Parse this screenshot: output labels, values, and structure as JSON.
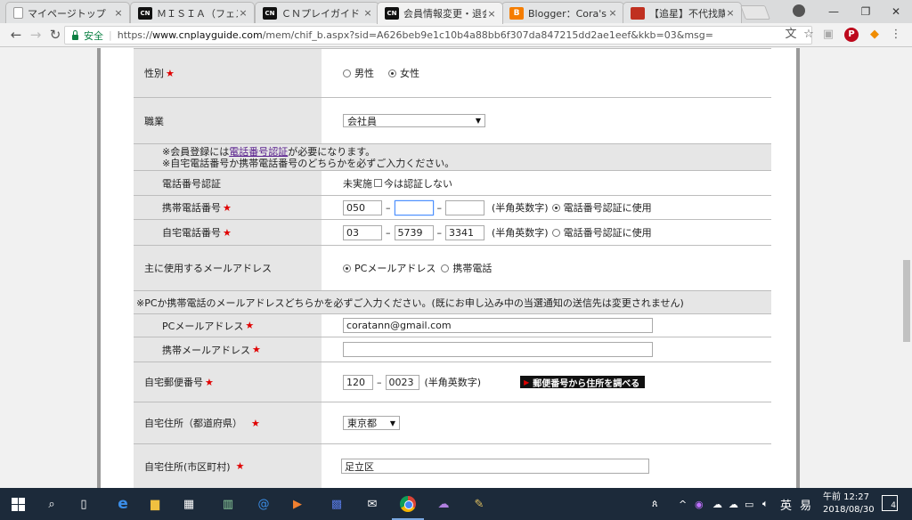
{
  "browser": {
    "tabs": [
      {
        "favicon": "page-icon",
        "favicon_text": "",
        "title": "マイページトップ",
        "active": false
      },
      {
        "favicon": "cn-icon",
        "favicon_text": "CN",
        "title": "ＭＩＳＩＡ（フェスティ",
        "active": false
      },
      {
        "favicon": "cn-icon",
        "favicon_text": "CN",
        "title": "ＣＮプレイガイド｜会員",
        "active": false
      },
      {
        "favicon": "cn-icon",
        "favicon_text": "CN",
        "title": "会員情報変更・退会",
        "active": true
      },
      {
        "favicon": "blogger-icon",
        "favicon_text": "B",
        "title": "Blogger：Cora's Tast",
        "active": false
      },
      {
        "favicon": "news-icon",
        "favicon_text": "",
        "title": "【追星】不代找購、不",
        "active": false
      }
    ],
    "tab_close": "×",
    "window_controls": {
      "minimize": "—",
      "restore": "❐",
      "close": "✕"
    },
    "nav": {
      "back": "←",
      "forward": "→",
      "reload": "↻"
    },
    "omnibox": {
      "secure_label": "安全",
      "url_scheme": "https://",
      "url_host": "www.cnplayguide.com",
      "url_path": "/mem/chif_b.aspx?sid=A626beb9e1c10b4a88bb6f307da847215dd2ae1eef&kkb=03&msg="
    },
    "toolbar_icons": {
      "translate": "文",
      "bookmark": "☆",
      "ext1": "▣",
      "pinterest": "P",
      "ext2": "◆",
      "menu": "⋮"
    }
  },
  "form": {
    "gender": {
      "label": "性別",
      "options": [
        "男性",
        "女性"
      ],
      "selected": "女性"
    },
    "occupation": {
      "label": "職業",
      "value": "会社員"
    },
    "notice": {
      "line1_prefix": "※会員登録には",
      "line1_link": "電話番号認証",
      "line1_suffix": "が必要になります。",
      "line2": "※自宅電話番号か携帯電話番号のどちらかを必ずご入力ください。"
    },
    "phone_auth": {
      "label": "電話番号認証",
      "status": "未実施",
      "skip_label": "今は認証しない"
    },
    "mobile_phone": {
      "label": "携帯電話番号",
      "part1": "050",
      "part2": "",
      "part3": "",
      "hint": "(半角英数字)",
      "auth_label": "電話番号認証に使用",
      "auth_selected": true
    },
    "home_phone": {
      "label": "自宅電話番号",
      "part1": "03",
      "part2": "5739",
      "part3": "3341",
      "hint": "(半角英数字)",
      "auth_label": "電話番号認証に使用",
      "auth_selected": false
    },
    "main_email": {
      "label": "主に使用するメールアドレス",
      "options": [
        "PCメールアドレス",
        "携帯電話"
      ],
      "selected": "PCメールアドレス"
    },
    "email_notice": "※PCか携帯電話のメールアドレスどちらかを必ずご入力ください。(既にお申し込み中の当選通知の送信先は変更されません)",
    "pc_email": {
      "label": "PCメールアドレス",
      "value": "coratann@gmail.com"
    },
    "mobile_email": {
      "label": "携帯メールアドレス",
      "value": ""
    },
    "postal": {
      "label": "自宅郵便番号",
      "part1": "120",
      "part2": "0023",
      "hint": "(半角英数字)",
      "lookup_button": "郵便番号から住所を調べる"
    },
    "prefecture": {
      "label": "自宅住所（都道府県）",
      "value": "東京都"
    },
    "city": {
      "label": "自宅住所(市区町村)",
      "value": "足立区"
    },
    "required_mark": "★"
  },
  "taskbar": {
    "clock_line1": "午前 12:27",
    "clock_line2": "2018/08/30",
    "ime_lang": "英",
    "ime_mode": "易",
    "notification_count": "4"
  }
}
